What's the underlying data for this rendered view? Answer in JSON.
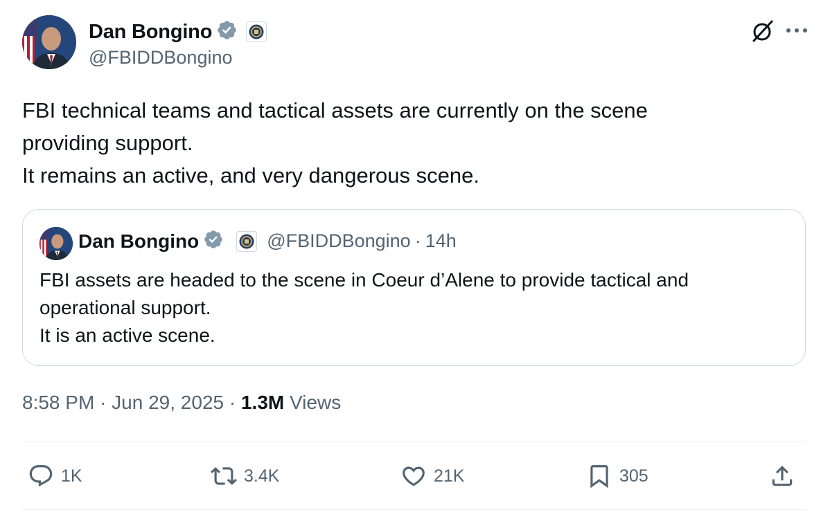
{
  "tweet": {
    "author": {
      "name": "Dan Bongino",
      "handle": "@FBIDDBongino"
    },
    "text_lines": [
      "FBI technical teams and tactical assets are currently on the scene",
      "providing support.",
      "It remains an active, and very dangerous scene."
    ],
    "quote": {
      "name": "Dan Bongino",
      "handle": "@FBIDDBongino",
      "separator": "·",
      "age": "14h",
      "text_lines": [
        "FBI assets are headed to the scene in Coeur d’Alene to provide tactical and",
        "operational support.",
        "It is an active scene."
      ]
    },
    "meta": {
      "time": "8:58 PM",
      "sep1": "·",
      "date": "Jun 29, 2025",
      "sep2": "·",
      "views_count": "1.3M",
      "views_label": "Views"
    },
    "actions": {
      "replies": "1K",
      "reposts": "3.4K",
      "likes": "21K",
      "bookmarks": "305"
    }
  },
  "icons": {
    "verified": "verified-badge-icon",
    "affiliate": "fbi-seal-icon",
    "grok": "grok-icon",
    "more": "more-icon",
    "reply": "reply-icon",
    "repost": "repost-icon",
    "like": "heart-icon",
    "bookmark": "bookmark-icon",
    "share": "share-icon"
  },
  "colors": {
    "verified": "#829aab",
    "secondary_text": "#536471",
    "border": "#cfd9de"
  }
}
